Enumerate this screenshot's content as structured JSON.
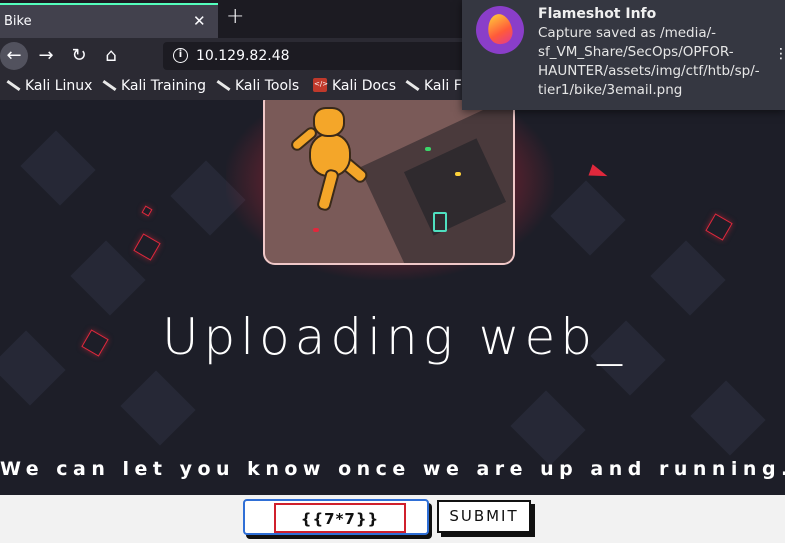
{
  "browser": {
    "tab_title": "Bike",
    "tab_close": "✕",
    "new_tab": "+",
    "url": "10.129.82.48"
  },
  "bookmarks": [
    {
      "label": "Kali Linux",
      "icon": "kali-icon"
    },
    {
      "label": "Kali Training",
      "icon": "kali-icon"
    },
    {
      "label": "Kali Tools",
      "icon": "kali-icon"
    },
    {
      "label": "Kali Docs",
      "icon": "docs-icon"
    },
    {
      "label": "Kali Forums",
      "icon": "kali-icon"
    }
  ],
  "page": {
    "headline": "Uploading web_",
    "subline": "We can let you know once we are up and running.",
    "email_value": "{{7*7}}",
    "submit_label": "SUBMIT",
    "accent_color": "#e0283c"
  },
  "notification": {
    "title": "Flameshot Info",
    "body": "Capture saved as /media/-sf_VM_Share/SecOps/OPFOR-HAUNTER/assets/img/ctf/htb/sp/-tier1/bike/3email.png"
  }
}
